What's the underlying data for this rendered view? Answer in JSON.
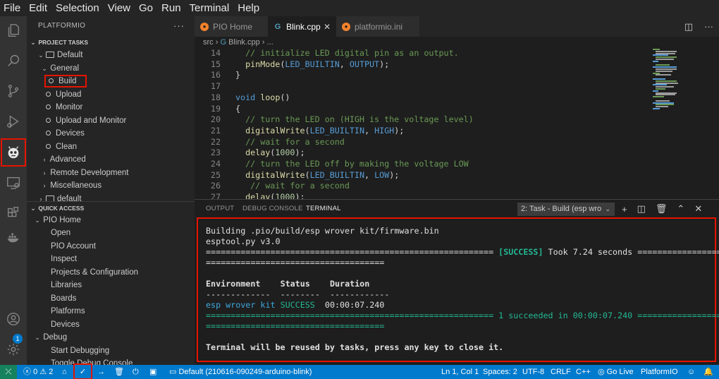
{
  "menu": [
    "File",
    "Edit",
    "Selection",
    "View",
    "Go",
    "Run",
    "Terminal",
    "Help"
  ],
  "activity_icons": [
    "explorer-icon",
    "search-icon",
    "source-control-icon",
    "run-debug-icon",
    "platformio-icon",
    "remote-explorer-icon",
    "extensions-icon",
    "docker-icon",
    "accounts-icon",
    "settings-icon"
  ],
  "settings_badge": "1",
  "sidebar": {
    "title": "PLATFORMIO",
    "more": "···",
    "project_tasks": {
      "header": "PROJECT TASKS",
      "env": "Default",
      "general": "General",
      "tasks": [
        "Build",
        "Upload",
        "Monitor",
        "Upload and Monitor",
        "Devices",
        "Clean"
      ],
      "groups": [
        "Advanced",
        "Remote Development",
        "Miscellaneous"
      ],
      "env2": "default"
    },
    "quick_access": {
      "header": "QUICK ACCESS",
      "pio_home": "PIO Home",
      "home_items": [
        "Open",
        "PIO Account",
        "Inspect",
        "Projects & Configuration",
        "Libraries",
        "Boards",
        "Platforms",
        "Devices"
      ],
      "debug": "Debug",
      "debug_items": [
        "Start Debugging",
        "Toggle Debug Console"
      ]
    }
  },
  "tabs": [
    {
      "label": "PIO Home",
      "active": false
    },
    {
      "label": "Blink.cpp",
      "active": true
    },
    {
      "label": "platformio.ini",
      "active": false
    }
  ],
  "breadcrumb": {
    "folder": "src",
    "file": "Blink.cpp",
    "tail": "..."
  },
  "code": [
    {
      "n": "14",
      "text": "  // initialize LED digital pin as an output."
    },
    {
      "n": "15",
      "text": "  pinMode(LED_BUILTIN, OUTPUT);"
    },
    {
      "n": "16",
      "text": "}"
    },
    {
      "n": "17",
      "text": ""
    },
    {
      "n": "18",
      "text": "void loop()"
    },
    {
      "n": "19",
      "text": "{"
    },
    {
      "n": "20",
      "text": "  // turn the LED on (HIGH is the voltage level)"
    },
    {
      "n": "21",
      "text": "  digitalWrite(LED_BUILTIN, HIGH);"
    },
    {
      "n": "22",
      "text": "  // wait for a second"
    },
    {
      "n": "23",
      "text": "  delay(1000);"
    },
    {
      "n": "24",
      "text": "  // turn the LED off by making the voltage LOW"
    },
    {
      "n": "25",
      "text": "  digitalWrite(LED_BUILTIN, LOW);"
    },
    {
      "n": "26",
      "text": "   // wait for a second"
    },
    {
      "n": "27",
      "text": "  delay(1000);"
    }
  ],
  "panel": {
    "tabs": [
      "OUTPUT",
      "DEBUG CONSOLE",
      "TERMINAL"
    ],
    "task_select": "2: Task - Build (esp wro"
  },
  "terminal": {
    "line1": "Building .pio/build/esp wrover kit/firmware.bin",
    "line2": "esptool.py v3.0",
    "sep_a": "========================================================== ",
    "success": "[SUCCESS]",
    "took": " Took 7.24 seconds ==================",
    "sep_b": "====================================",
    "col_env": "Environment",
    "col_status": "Status",
    "col_duration": "Duration",
    "dash_env": "-------------",
    "dash_status": "--------",
    "dash_duration": "------------",
    "row_env": "esp wrover kit",
    "row_status": "SUCCESS",
    "row_duration": "00:00:07.240",
    "summary": "========================================================== 1 succeeded in 00:00:07.240 ===================",
    "summary_b": "====================================",
    "reuse": "Terminal will be reused by tasks, press any key to close it."
  },
  "status": {
    "errors": "0",
    "warnings": "2",
    "env": "Default (210616-090249-arduino-blink)",
    "position": "Ln 1, Col 1",
    "spaces": "Spaces: 2",
    "encoding": "UTF-8",
    "eol": "CRLF",
    "language": "C++",
    "golive": "Go Live",
    "platformio": "PlatformIO"
  }
}
